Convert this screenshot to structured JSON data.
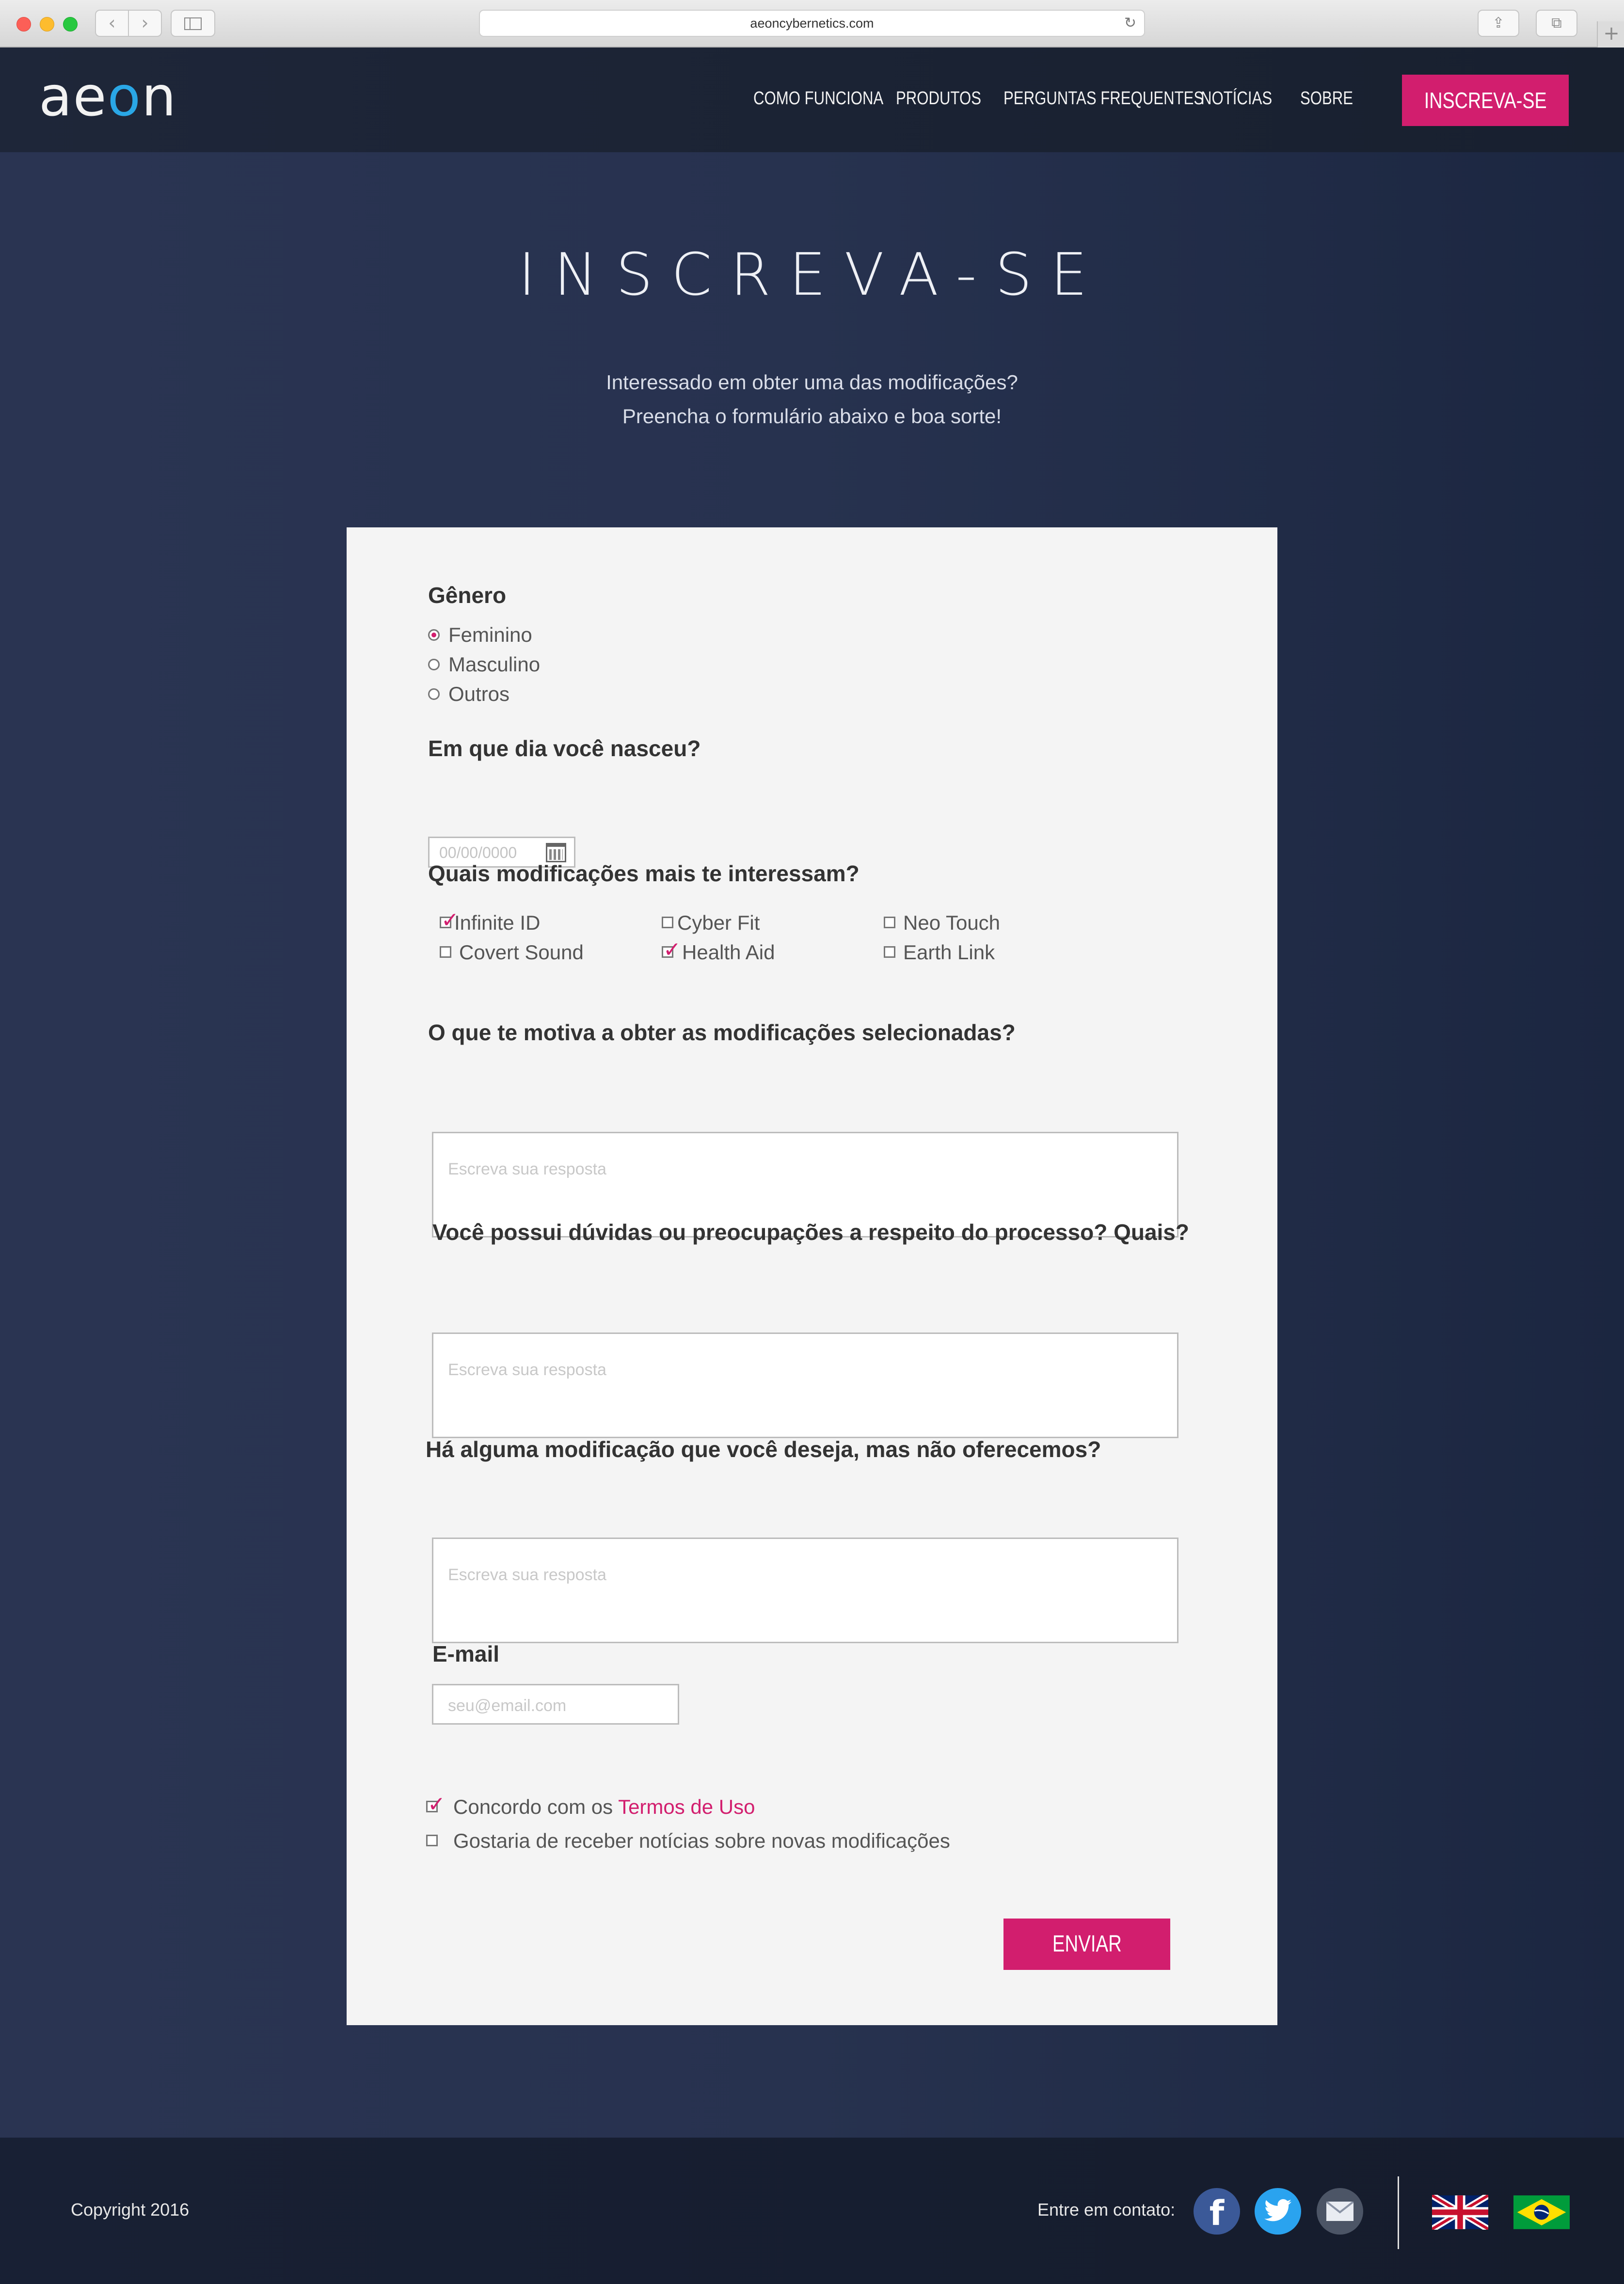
{
  "browser": {
    "url": "aeoncybernetics.com",
    "back_glyph": "‹",
    "forward_glyph": "›",
    "reload_glyph": "↻",
    "share_glyph": "⇪",
    "tabs_glyph": "⧉",
    "newtab_glyph": "+"
  },
  "header": {
    "logo": {
      "before": "ae",
      "accent": "o",
      "after": "n"
    },
    "nav": [
      "COMO FUNCIONA",
      "PRODUTOS",
      "PERGUNTAS FREQUENTES",
      "NOTÍCIAS",
      "SOBRE"
    ],
    "cta": "INSCREVA-SE"
  },
  "hero": {
    "title": "INSCREVA-SE",
    "subtitle_line1": "Interessado em obter uma das modificações?",
    "subtitle_line2": "Preencha o formulário abaixo e boa sorte!"
  },
  "form": {
    "gender": {
      "label": "Gênero",
      "options": [
        {
          "label": "Feminino",
          "selected": true
        },
        {
          "label": "Masculino",
          "selected": false
        },
        {
          "label": "Outros",
          "selected": false
        }
      ]
    },
    "birthdate": {
      "label": "Em que dia você nasceu?",
      "placeholder": "00/00/0000"
    },
    "mods": {
      "label": "Quais modificações mais te interessam?",
      "options": [
        {
          "label": "Infinite ID",
          "checked": true
        },
        {
          "label": "Cyber Fit",
          "checked": false
        },
        {
          "label": "Neo Touch",
          "checked": false
        },
        {
          "label": "Covert Sound",
          "checked": false
        },
        {
          "label": "Health Aid",
          "checked": true
        },
        {
          "label": "Earth Link",
          "checked": false
        }
      ]
    },
    "motivation": {
      "label": "O que te motiva a obter as modificações selecionadas?",
      "placeholder": "Escreva sua resposta"
    },
    "doubts": {
      "label": "Você possui dúvidas ou preocupações a respeito do processo? Quais?",
      "placeholder": "Escreva sua resposta"
    },
    "wishes": {
      "label": "Há alguma modificação que você deseja, mas não oferecemos?",
      "placeholder": "Escreva sua resposta"
    },
    "email": {
      "label": "E-mail",
      "placeholder": "seu@email.com"
    },
    "terms": {
      "prefix": "Concordo com os ",
      "link": "Termos de Uso",
      "checked": true
    },
    "newsletter": {
      "label": "Gostaria de receber notícias sobre novas modificações",
      "checked": false
    },
    "submit": "ENVIAR"
  },
  "footer": {
    "copyright": "Copyright 2016",
    "contact_label": "Entre em contato:",
    "social_icons": [
      "facebook-icon",
      "twitter-icon",
      "email-icon"
    ],
    "languages": [
      "uk-flag",
      "brazil-flag"
    ]
  },
  "colors": {
    "accent": "#d21e6e",
    "logo_blue": "#2aa7e6",
    "page_bg": "#27324f",
    "card_bg": "#f4f4f4"
  }
}
